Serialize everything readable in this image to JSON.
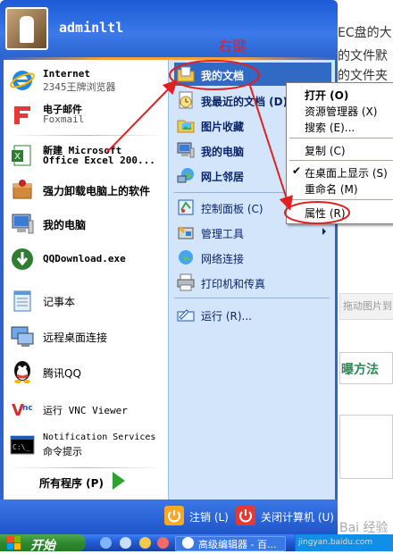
{
  "user": {
    "name": "adminltl"
  },
  "background": {
    "lines": [
      "EC盘的大",
      "的文件默",
      "的文件夹"
    ],
    "gray_text": "拖动图片到",
    "green_text": "曝方法"
  },
  "left_panel": {
    "pinned": [
      {
        "title": "Internet",
        "subtitle": "2345王牌浏览器",
        "icon": "ie-icon"
      },
      {
        "title": "电子邮件",
        "subtitle": "Foxmail",
        "icon": "foxmail-icon"
      }
    ],
    "recent": [
      {
        "title": "新建 Microsoft",
        "subtitle": "Office Excel 200...",
        "icon": "excel-icon"
      },
      {
        "label": "强力卸载电脑上的软件",
        "icon": "uninstall-icon"
      },
      {
        "label": "我的电脑",
        "icon": "computer-icon"
      },
      {
        "label": "QQDownload.exe",
        "icon": "download-icon"
      },
      {
        "label": "记事本",
        "icon": "notepad-icon"
      },
      {
        "label": "远程桌面连接",
        "icon": "remote-desktop-icon"
      },
      {
        "label": "腾讯QQ",
        "icon": "qq-icon"
      },
      {
        "label": "运行 VNC Viewer",
        "icon": "vnc-icon"
      },
      {
        "title": "Notification Services",
        "subtitle": "命令提示",
        "icon": "cmd-icon"
      }
    ],
    "all_programs": "所有程序 (P)"
  },
  "right_panel": {
    "items": [
      {
        "label": "我的文档",
        "icon": "my-documents-icon"
      },
      {
        "label": "我最近的文档 (D)",
        "icon": "recent-docs-icon"
      },
      {
        "label": "图片收藏",
        "icon": "pictures-icon"
      },
      {
        "label": "我的电脑",
        "icon": "my-computer-icon"
      },
      {
        "label": "网上邻居",
        "icon": "network-icon"
      },
      {
        "label": "控制面板 (C)",
        "icon": "control-panel-icon"
      },
      {
        "label": "管理工具",
        "icon": "admin-tools-icon"
      },
      {
        "label": "网络连接",
        "icon": "network-connections-icon"
      },
      {
        "label": "打印机和传真",
        "icon": "printer-icon"
      },
      {
        "label": "运行 (R)...",
        "icon": "run-icon"
      }
    ]
  },
  "footer": {
    "logoff": "注销 (L)",
    "shutdown": "关闭计算机 (U)"
  },
  "context_menu": {
    "items": [
      "打开 (O)",
      "资源管理器 (X)",
      "搜索 (E)...",
      "复制 (C)",
      "在桌面上显示 (S)",
      "重命名 (M)",
      "属性 (R)"
    ]
  },
  "taskbar": {
    "start": "开始",
    "task": "高级编辑器 - 百..."
  },
  "annotation": {
    "label": "右键"
  },
  "watermark": {
    "main": "Bai 经验",
    "sub": "jingyan.baidu.com"
  }
}
